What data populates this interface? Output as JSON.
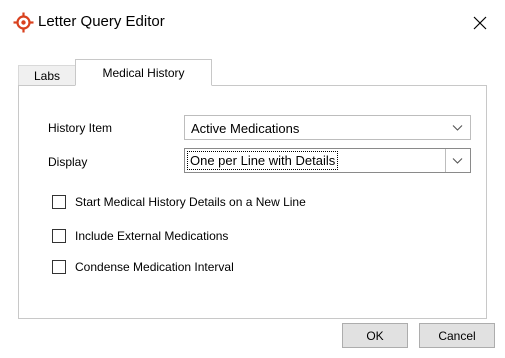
{
  "window": {
    "title": "Letter Query Editor",
    "icon": "crosshair-gear-icon",
    "accent_color": "#d9411e"
  },
  "tabs": [
    {
      "label": "Labs",
      "active": false
    },
    {
      "label": "Medical History",
      "active": true
    }
  ],
  "form": {
    "history_item": {
      "label": "History Item",
      "value": "Active Medications"
    },
    "display": {
      "label": "Display",
      "value": "One per Line with Details"
    }
  },
  "checkboxes": [
    {
      "label": "Start Medical History Details on a New Line",
      "checked": false
    },
    {
      "label": "Include External Medications",
      "checked": false
    },
    {
      "label": "Condense Medication Interval",
      "checked": false
    }
  ],
  "buttons": {
    "ok": "OK",
    "cancel": "Cancel"
  }
}
